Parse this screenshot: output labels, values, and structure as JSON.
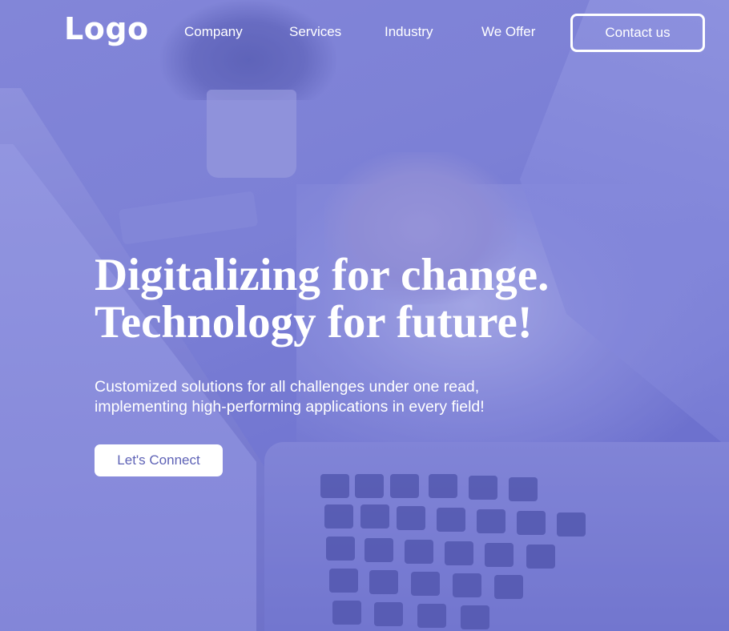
{
  "nav": {
    "logo": "Logo",
    "links": [
      "Company",
      "Services",
      "Industry",
      "We Offer"
    ],
    "contact_label": "Contact us"
  },
  "hero": {
    "headline_lines": [
      "Digitalizing for change.",
      "Technology for future!"
    ],
    "subtext_lines": [
      "Customized solutions for all challenges under one read,",
      "implementing high-performing applications in every field!"
    ],
    "cta_label": "Let's Connect",
    "background_image": "laptop-desk-photo",
    "overlay_color": "#6a6ed0"
  },
  "colors": {
    "accent": "#6a6ed0",
    "cta_text": "#5e62b6",
    "text": "#ffffff"
  }
}
